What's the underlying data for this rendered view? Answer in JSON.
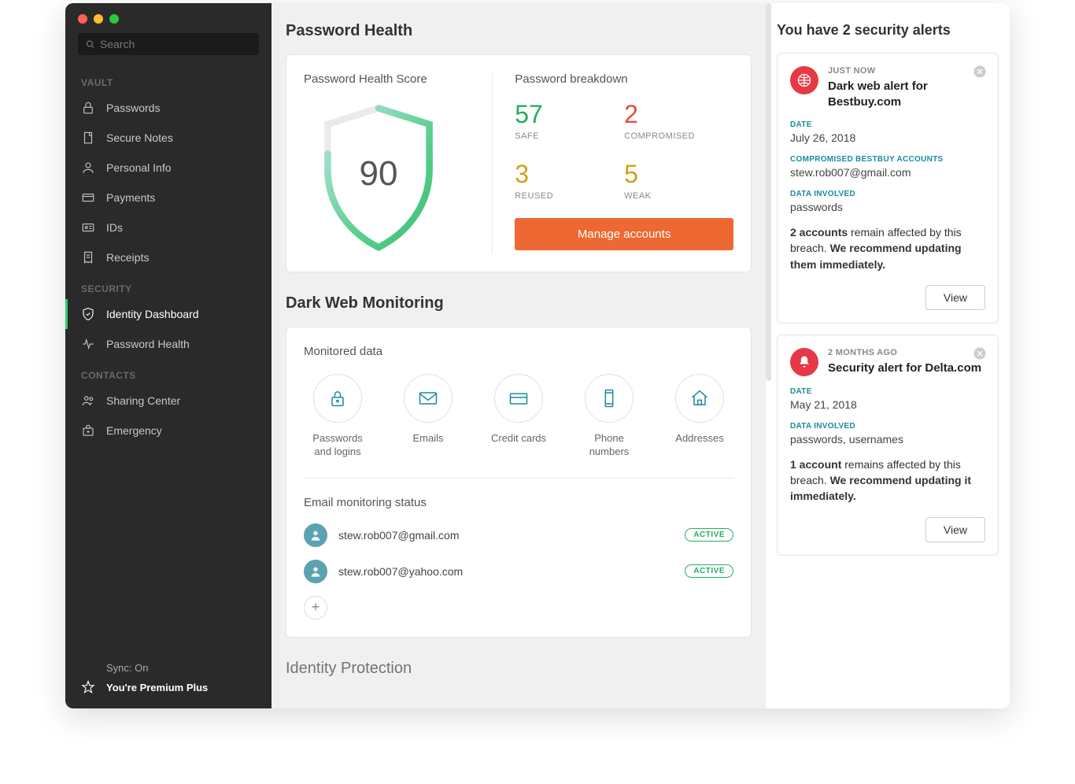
{
  "search": {
    "placeholder": "Search"
  },
  "sidebar": {
    "sections": {
      "vault": {
        "header": "VAULT",
        "items": [
          "Passwords",
          "Secure Notes",
          "Personal Info",
          "Payments",
          "IDs",
          "Receipts"
        ]
      },
      "security": {
        "header": "SECURITY",
        "items": [
          "Identity Dashboard",
          "Password Health"
        ]
      },
      "contacts": {
        "header": "CONTACTS",
        "items": [
          "Sharing Center",
          "Emergency"
        ]
      }
    },
    "footer": {
      "sync": "Sync: On",
      "premium": "You're Premium Plus"
    }
  },
  "main": {
    "ph_title": "Password Health",
    "ph_score_label": "Password Health Score",
    "ph_score": "90",
    "breakdown_label": "Password breakdown",
    "breakdown": {
      "safe": {
        "n": "57",
        "l": "SAFE"
      },
      "compromised": {
        "n": "2",
        "l": "COMPROMISED"
      },
      "reused": {
        "n": "3",
        "l": "REUSED"
      },
      "weak": {
        "n": "5",
        "l": "WEAK"
      }
    },
    "manage_btn": "Manage accounts",
    "dwm_title": "Dark Web Monitoring",
    "monitored_label": "Monitored data",
    "monitored": [
      "Passwords and logins",
      "Emails",
      "Credit cards",
      "Phone numbers",
      "Addresses"
    ],
    "email_status_label": "Email monitoring status",
    "emails": [
      {
        "addr": "stew.rob007@gmail.com",
        "status": "ACTIVE"
      },
      {
        "addr": "stew.rob007@yahoo.com",
        "status": "ACTIVE"
      }
    ],
    "identity_protection": "Identity Protection"
  },
  "alerts": {
    "header": "You have 2 security alerts",
    "items": [
      {
        "time": "JUST NOW",
        "title": "Dark web alert for Bestbuy.com",
        "date_label": "DATE",
        "date": "July 26, 2018",
        "comp_label": "COMPROMISED BESTBUY ACCOUNTS",
        "comp_val": "stew.rob007@gmail.com",
        "data_label": "DATA INVOLVED",
        "data_val": "passwords",
        "msg_bold1": "2 accounts",
        "msg_mid": " remain affected by this breach. ",
        "msg_bold2": "We recommend updating them immediately.",
        "view": "View"
      },
      {
        "time": "2 MONTHS AGO",
        "title": "Security alert for Delta.com",
        "date_label": "DATE",
        "date": "May 21, 2018",
        "data_label": "DATA INVOLVED",
        "data_val": "passwords, usernames",
        "msg_bold1": "1 account",
        "msg_mid": " remains affected by this breach. ",
        "msg_bold2": "We recommend updating it immediately.",
        "view": "View"
      }
    ]
  }
}
